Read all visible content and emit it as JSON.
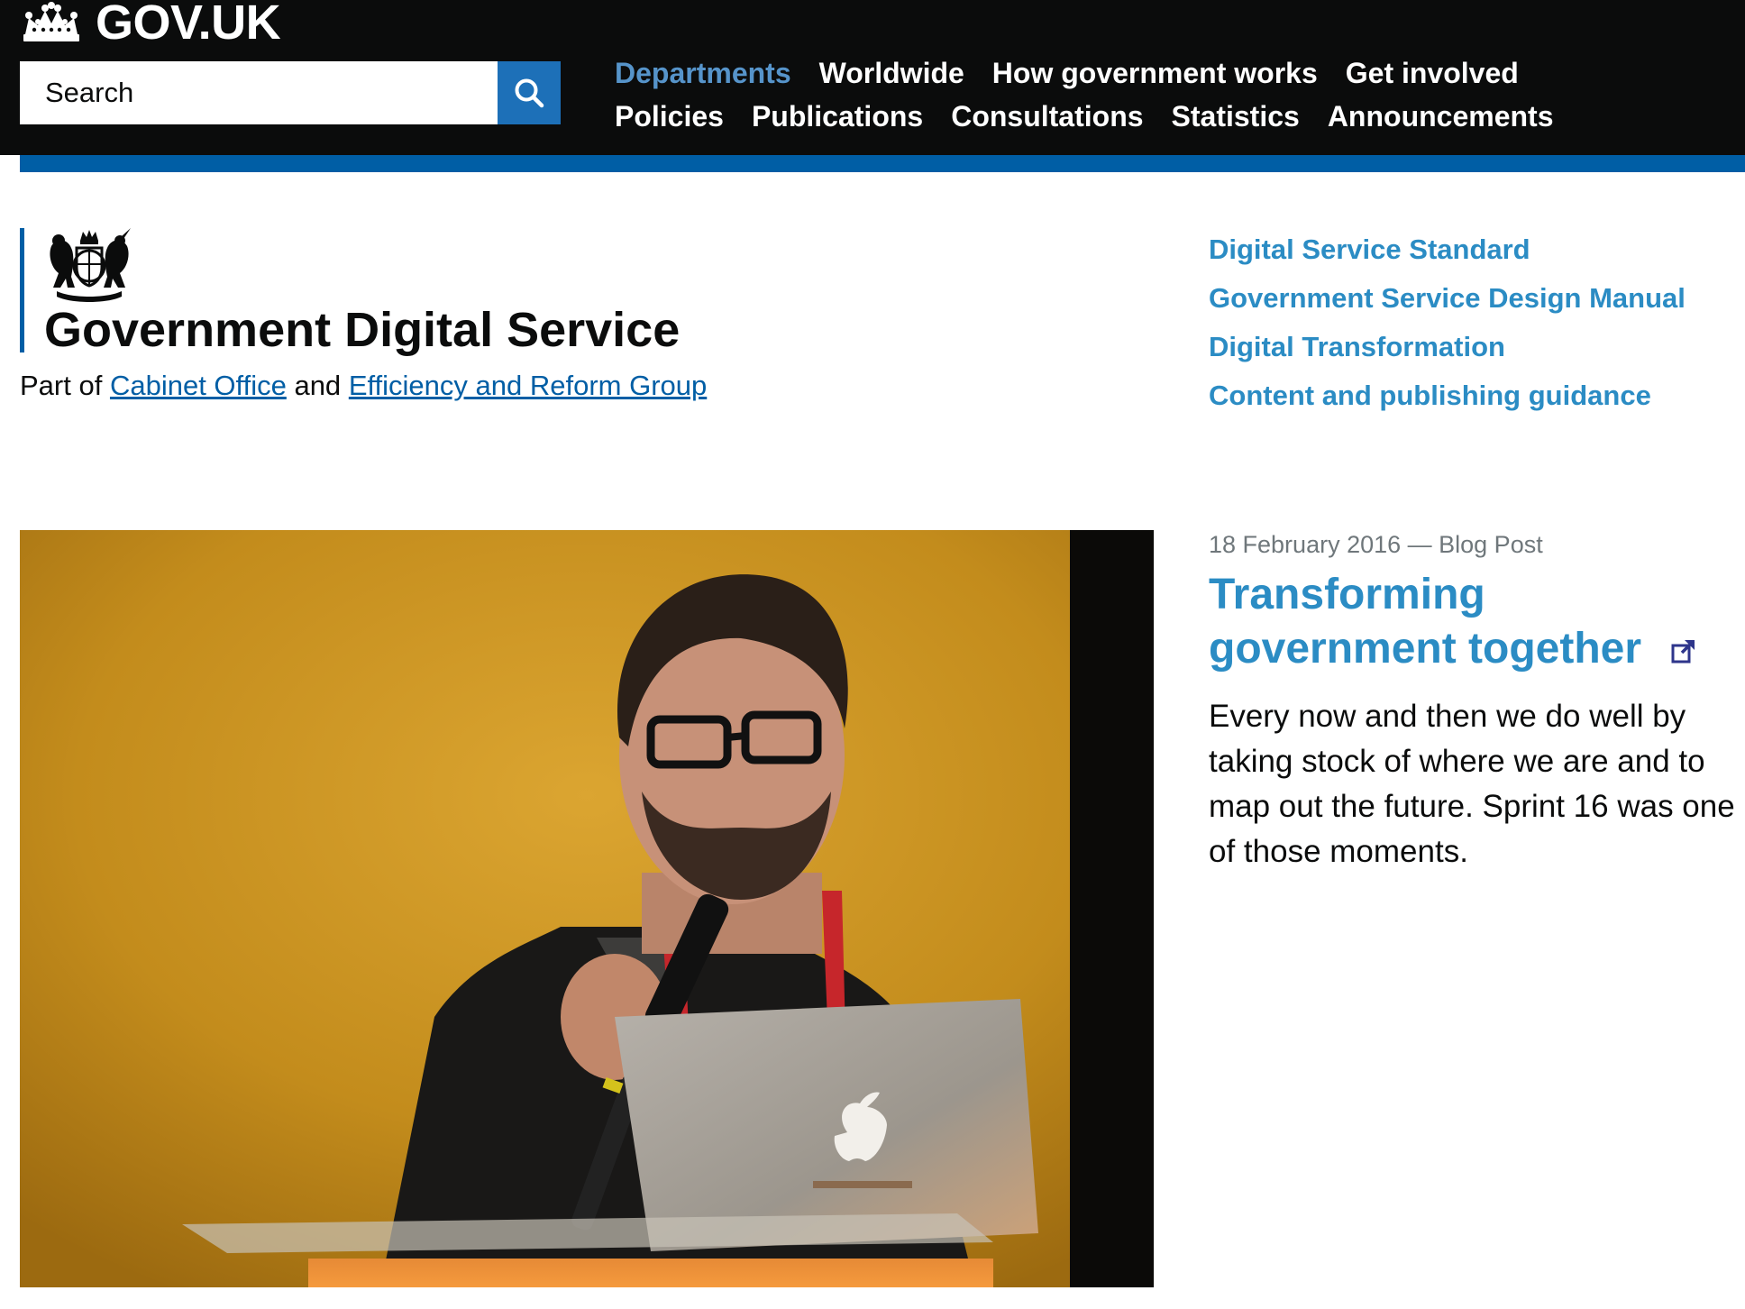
{
  "header": {
    "brand": "GOV.UK",
    "search_placeholder": "Search",
    "nav_row1": [
      "Departments",
      "Worldwide",
      "How government works",
      "Get involved"
    ],
    "nav_row2": [
      "Policies",
      "Publications",
      "Consultations",
      "Statistics",
      "Announcements"
    ],
    "active_nav": "Departments"
  },
  "org": {
    "title": "Government Digital Service",
    "parent_prefix": "Part of",
    "parent_link1": "Cabinet Office",
    "parent_joiner": "and",
    "parent_link2": "Efficiency and Reform Group"
  },
  "quick_links": [
    "Digital Service Standard",
    "Government Service Design Manual",
    "Digital Transformation",
    "Content and publishing guidance"
  ],
  "feature": {
    "meta": "18 February 2016 — Blog Post",
    "headline": "Transforming government together",
    "summary": "Every now and then we do well by taking stock of where we are and to map out the future. Sprint 16 was one of those moments."
  },
  "colors": {
    "header_bg": "#0b0c0c",
    "accent_blue": "#005ea5",
    "link_blue": "#2b8cc4",
    "active_nav": "#5694ca"
  },
  "icons": [
    "crown-icon",
    "search-icon",
    "royal-coat-of-arms-icon",
    "external-link-icon"
  ]
}
